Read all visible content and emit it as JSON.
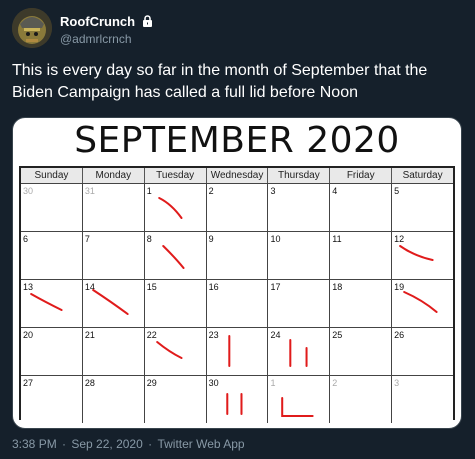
{
  "user": {
    "display_name": "RoofCrunch",
    "handle": "@admrlcrnch",
    "protected_icon": "lock-icon"
  },
  "tweet": {
    "text": "This is every day so far in the month of September that the Biden Campaign has called a full lid before Noon"
  },
  "calendar": {
    "title": "SEPTEMBER 2020",
    "day_names": [
      "Sunday",
      "Monday",
      "Tuesday",
      "Wednesday",
      "Thursday",
      "Friday",
      "Saturday"
    ],
    "weeks": [
      [
        "30",
        "31",
        "1",
        "2",
        "3",
        "4",
        "5"
      ],
      [
        "6",
        "7",
        "8",
        "9",
        "10",
        "11",
        "12"
      ],
      [
        "13",
        "14",
        "15",
        "16",
        "17",
        "18",
        "19"
      ],
      [
        "20",
        "21",
        "22",
        "23",
        "24",
        "25",
        "26"
      ],
      [
        "27",
        "28",
        "29",
        "30",
        "1",
        "2",
        "3"
      ]
    ],
    "marked_days": [
      "1",
      "8",
      "12",
      "13",
      "14",
      "19",
      "22",
      "23",
      "24",
      "30"
    ],
    "mark_color": "#e01b1b"
  },
  "footer": {
    "time": "3:38 PM",
    "date": "Sep 22, 2020",
    "source": "Twitter Web App"
  }
}
